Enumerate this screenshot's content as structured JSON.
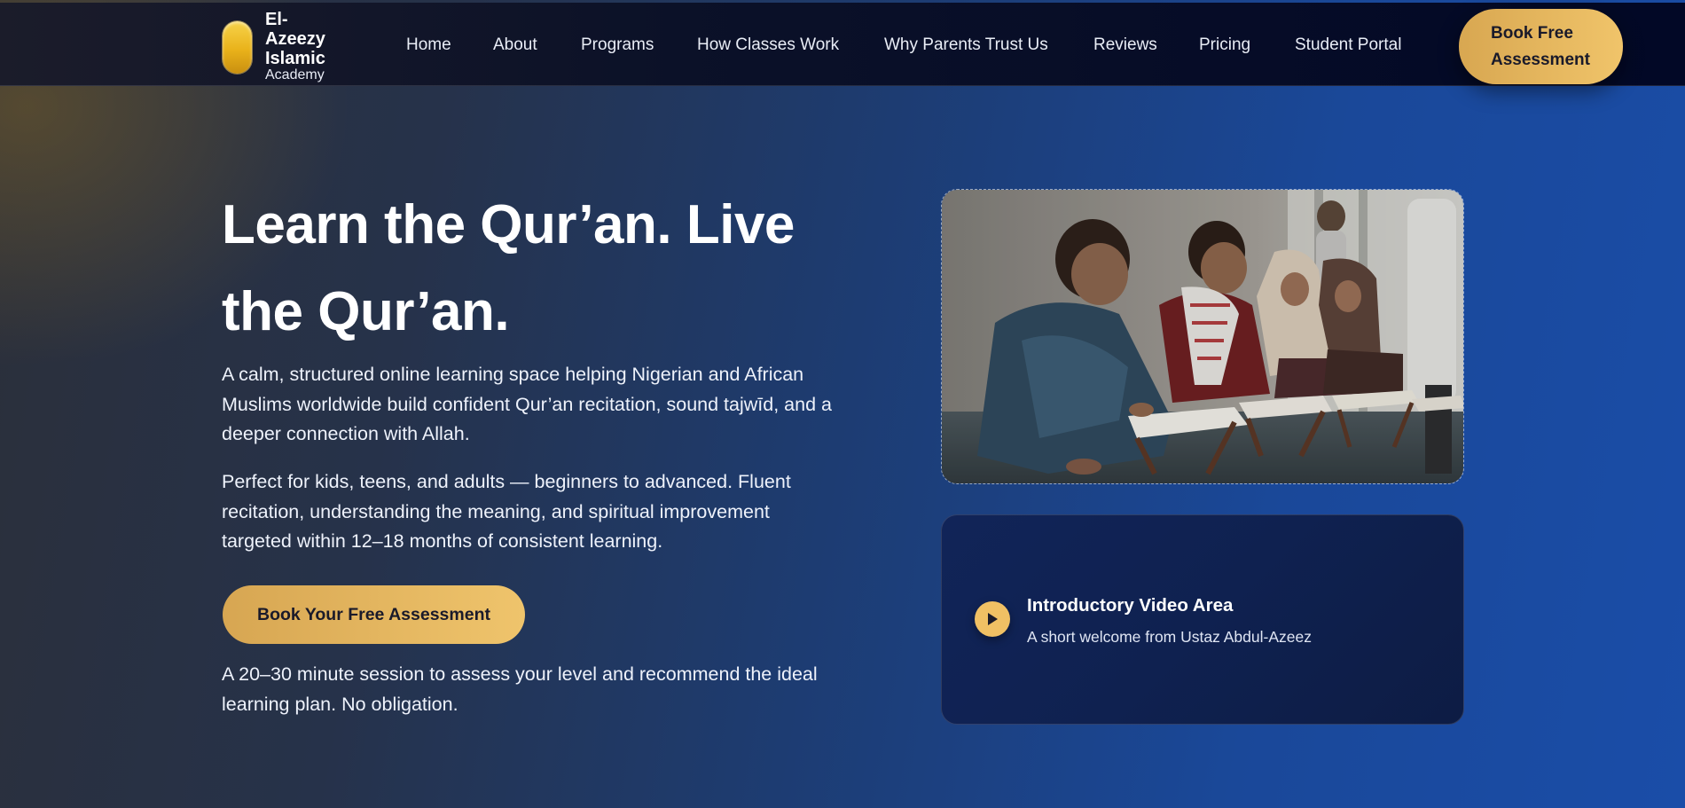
{
  "brand": {
    "name_lines": [
      "El-",
      "Azeezy",
      "Islamic"
    ],
    "sub": "Academy"
  },
  "nav": {
    "links": [
      "Home",
      "About",
      "Programs",
      "How Classes Work",
      "Why Parents Trust Us",
      "Reviews",
      "Pricing",
      "Student Portal"
    ],
    "cta_lines": [
      "Book Free",
      "Assessment"
    ]
  },
  "hero": {
    "title_lines": [
      "Learn the Qur’an. Live",
      "the Qur’an."
    ],
    "paragraph1": "A calm, structured online learning space helping Nigerian and African Muslims worldwide build confident Qur’an recitation, sound tajwīd, and a deeper connection with Allah.",
    "paragraph2": "Perfect for kids, teens, and adults — beginners to advanced. Fluent recitation, understanding the meaning, and spiritual improvement targeted within 12–18 months of consistent learning.",
    "cta": "Book Your Free Assessment",
    "note": "A 20–30 minute session to assess your level and recommend the ideal learning plan. No obligation."
  },
  "video": {
    "title": "Introductory Video Area",
    "subtitle": "A short welcome from Ustaz Abdul-Azeez"
  },
  "colors": {
    "accent_gold": "#eec066",
    "nav_bg": "#020826",
    "hero_blue": "#1a4da8"
  }
}
